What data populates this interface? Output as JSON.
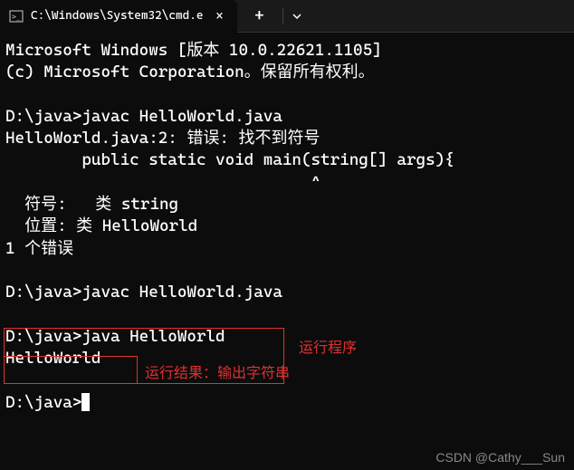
{
  "titlebar": {
    "tab_title": "C:\\Windows\\System32\\cmd.e",
    "close_glyph": "×",
    "newtab_glyph": "+",
    "dropdown_glyph": "⌄"
  },
  "terminal": {
    "line1": "Microsoft Windows [版本 10.0.22621.1105]",
    "line2": "(c) Microsoft Corporation。保留所有权利。",
    "line3": "",
    "line4": "D:\\java>javac HelloWorld.java",
    "line5": "HelloWorld.java:2: 错误: 找不到符号",
    "line6": "        public static void main(string[] args){",
    "line7": "                                ^",
    "line8": "  符号:   类 string",
    "line9": "  位置: 类 HelloWorld",
    "line10": "1 个错误",
    "line11": "",
    "line12": "D:\\java>javac HelloWorld.java",
    "line13": "",
    "line14": "D:\\java>java HelloWorld",
    "line15": "HelloWorld",
    "line16": "",
    "line17": "D:\\java>"
  },
  "annotations": {
    "run_program": "运行程序",
    "output_result": "运行结果：输出字符串"
  },
  "watermark": "CSDN @Cathy___Sun"
}
